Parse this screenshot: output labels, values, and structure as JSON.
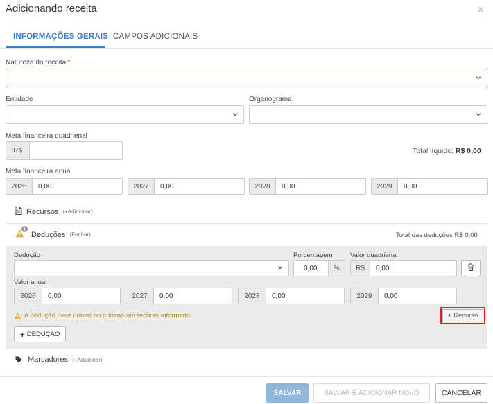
{
  "header": {
    "title": "Adicionando receita",
    "close_glyph": "×"
  },
  "tabs": [
    {
      "label": "INFORMAÇÕES GERAIS",
      "active": true
    },
    {
      "label": "CAMPOS ADICIONAIS",
      "active": false
    }
  ],
  "fields": {
    "natureza_label": "Natureza da receita",
    "required_mark": "*",
    "entidade_label": "Entidade",
    "organograma_label": "Organograma",
    "meta_quadrienal_label": "Meta financeira quadrienal",
    "currency": "R$",
    "total_liquido_label": "Total líquido:",
    "total_liquido_value": "R$ 0,00",
    "meta_anual_label": "Meta financeira anual",
    "anual": [
      {
        "year": "2026",
        "value": "0,00"
      },
      {
        "year": "2027",
        "value": "0,00"
      },
      {
        "year": "2028",
        "value": "0,00"
      },
      {
        "year": "2029",
        "value": "0,00"
      }
    ]
  },
  "recursos": {
    "label": "Recursos",
    "action": "(+Adicionar)"
  },
  "deducoes": {
    "badge": "1",
    "label": "Deduções",
    "action": "(Fechar)",
    "total_label": "Total das deduções R$ 0,00",
    "deducao_label": "Dedução",
    "porcentagem_label": "Porcentagem",
    "porcentagem_value": "0,00",
    "percent_symbol": "%",
    "valor_quadrienal_label": "Valor quadrienal",
    "valor_quadrienal_value": "0,00",
    "valor_anual_label": "Valor anual",
    "anual": [
      {
        "year": "2026",
        "value": "0,00"
      },
      {
        "year": "2027",
        "value": "0,00"
      },
      {
        "year": "2028",
        "value": "0,00"
      },
      {
        "year": "2029",
        "value": "0,00"
      }
    ],
    "warning": "A dedução deve conter no mínimo um recurso informado",
    "recurso_button": "Recurso",
    "add_deducao_button": "DEDUÇÃO"
  },
  "marcadores": {
    "label": "Marcadores",
    "action": "(+Adicionar)"
  },
  "footer": {
    "save": "SALVAR",
    "save_add_new": "SALVAR E ADICIONAR NOVO",
    "cancel": "CANCELAR"
  },
  "icons": {
    "close": "close-icon",
    "chevron": "chevron-down-icon",
    "document": "document-icon",
    "warning": "warning-icon",
    "tag": "tag-icon",
    "trash": "trash-icon",
    "plus": "plus-icon"
  },
  "colors": {
    "accent": "#3e7fc3",
    "error_border": "#c9302c",
    "warning": "#b58a18",
    "highlight": "#e02020",
    "primary_button": "#8fb6dd"
  }
}
